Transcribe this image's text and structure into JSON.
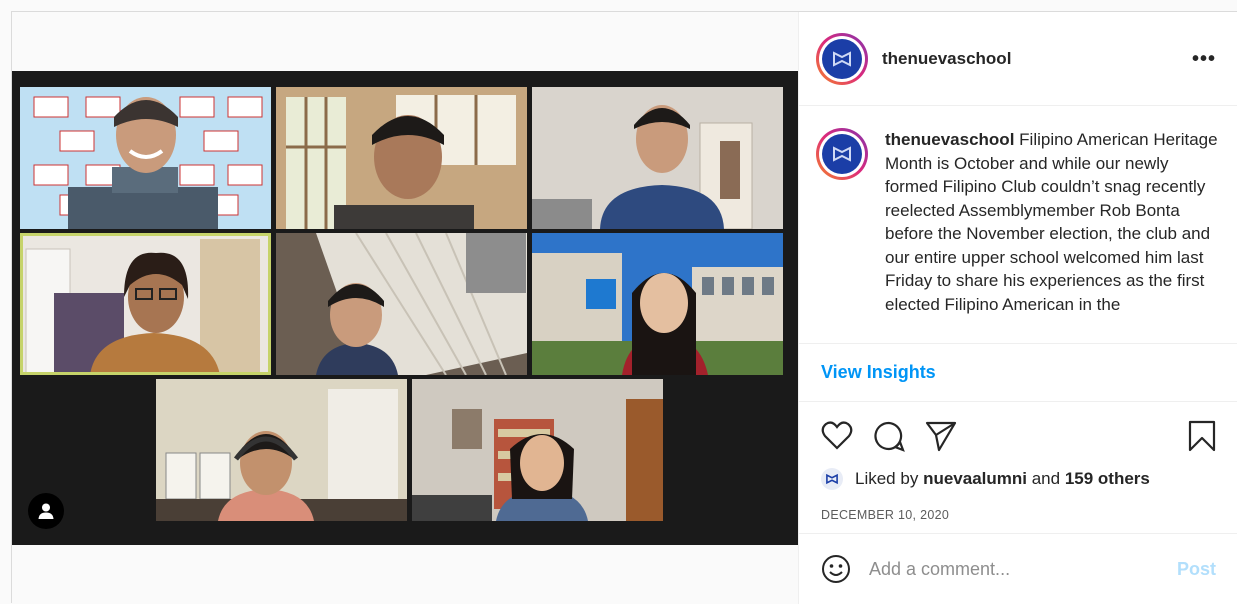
{
  "post": {
    "username": "thenuevaschool",
    "more_label": "•••",
    "caption": {
      "username": "thenuevaschool",
      "text": "Filipino American Heritage Month is October and while our newly formed Filipino Club couldn’t snag recently reelected Assemblymember Rob Bonta before the November election, the club and our entire upper school welcomed him last Friday to share his experiences as the first elected Filipino American in the"
    },
    "insights_label": "View Insights",
    "likes": {
      "prefix": "Liked by",
      "user": "nuevaalumni",
      "and": "and",
      "others": "159 others"
    },
    "date": "DECEMBER 10, 2020",
    "comment": {
      "placeholder": "Add a comment...",
      "post_label": "Post"
    }
  },
  "icons": {
    "like": "heart-icon",
    "comment": "comment-bubble-icon",
    "share": "paper-plane-icon",
    "save": "bookmark-icon",
    "emoji": "smiley-icon",
    "more": "more-dots-icon",
    "participant": "person-icon"
  },
  "colors": {
    "link_blue": "#0095f6",
    "post_disabled": "#b2dffc",
    "active_speaker_border": "#c6d36a",
    "zoom_bg": "#1a1a1a",
    "school_blue": "#1b3ea7"
  }
}
